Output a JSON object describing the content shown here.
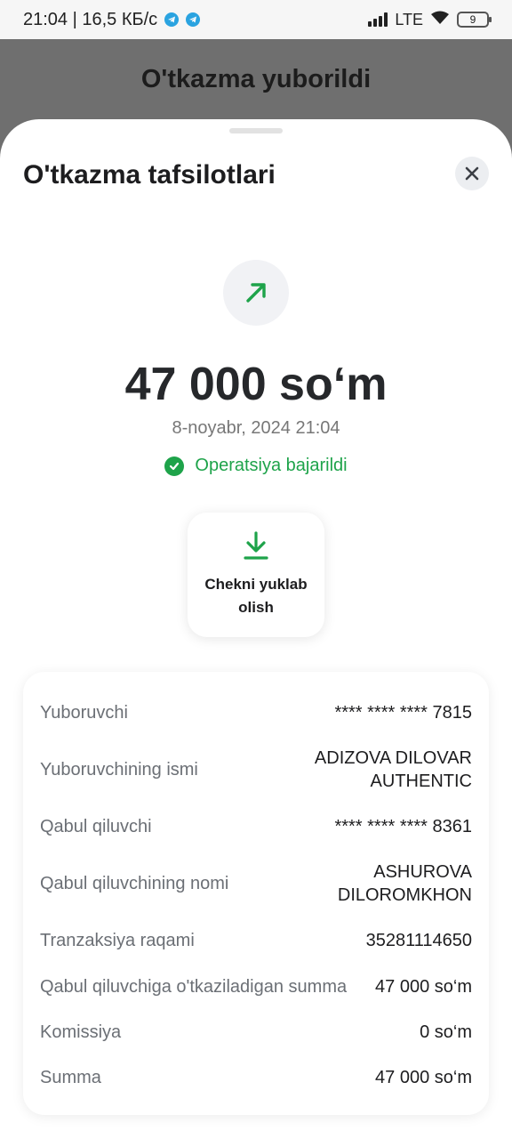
{
  "status_bar": {
    "time_speed": "21:04 | 16,5 КБ/с",
    "network": "LTE",
    "battery": "9"
  },
  "backdrop": {
    "title": "O'tkazma yuborildi"
  },
  "sheet": {
    "title": "O'tkazma tafsilotlari",
    "amount": "47 000 so‘m",
    "datetime": "8-noyabr, 2024 21:04",
    "status_text": "Operatsiya bajarildi",
    "receipt_button": "Chekni yuklab olish"
  },
  "details": [
    {
      "label": "Yuboruvchi",
      "value": "**** **** **** 7815"
    },
    {
      "label": "Yuboruvchining ismi",
      "value": "ADIZOVA DILOVAR AUTHENTIC"
    },
    {
      "label": "Qabul qiluvchi",
      "value": "**** **** **** 8361"
    },
    {
      "label": "Qabul qiluvchining nomi",
      "value": "ASHUROVA DILOROMKHON"
    },
    {
      "label": "Tranzaksiya raqami",
      "value": "35281114650"
    },
    {
      "label": "Qabul qiluvchiga o'tkaziladigan summa",
      "value": "47 000 so‘m"
    },
    {
      "label": "Komissiya",
      "value": "0 so‘m"
    },
    {
      "label": "Summa",
      "value": "47 000 so‘m"
    }
  ],
  "colors": {
    "accent_green": "#1ea34a",
    "backdrop": "#6f6f6f"
  },
  "icons": [
    "telegram-icon",
    "signal-icon",
    "wifi-icon",
    "battery-icon",
    "close-icon",
    "arrow-up-right-icon",
    "check-circle-icon",
    "download-icon"
  ]
}
